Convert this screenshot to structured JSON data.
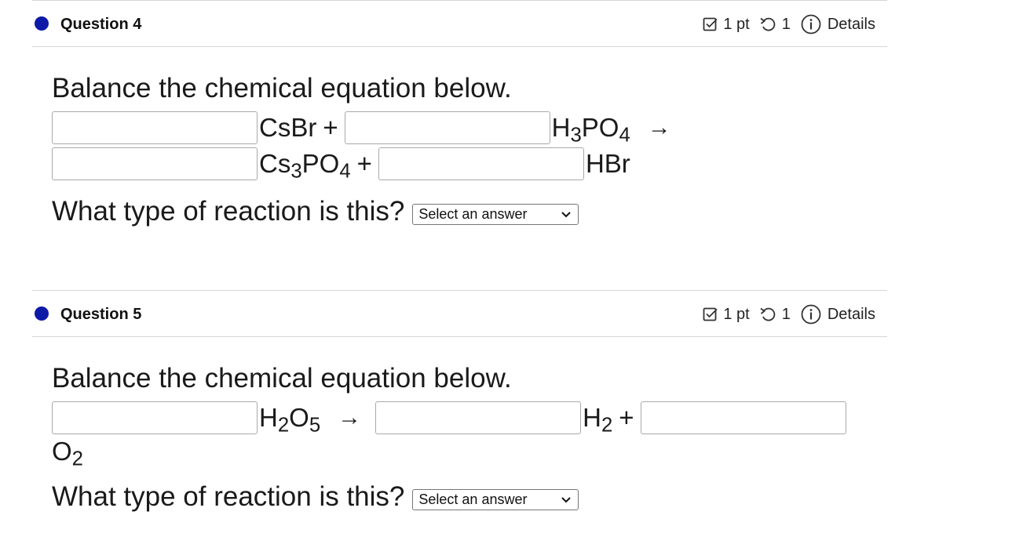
{
  "questions": [
    {
      "title": "Question 4",
      "points": "1 pt",
      "tries": "1",
      "details_label": "Details",
      "prompt": "Balance the chemical equation below.",
      "equation": {
        "r1": {
          "base": "CsBr",
          "parts": []
        },
        "plus1": "+",
        "r2": {
          "parts": [
            [
              "H",
              ""
            ],
            [
              "3",
              "sub"
            ],
            [
              "PO",
              ""
            ],
            [
              "4",
              "sub"
            ]
          ]
        },
        "arrow": "→",
        "p1": {
          "parts": [
            [
              "Cs",
              ""
            ],
            [
              "3",
              "sub"
            ],
            [
              "PO",
              ""
            ],
            [
              "4",
              "sub"
            ]
          ]
        },
        "plus2": "+",
        "p2": {
          "base": "HBr",
          "parts": []
        }
      },
      "coef_values": [
        "",
        "",
        "",
        ""
      ],
      "type_question": "What type of reaction is this?",
      "type_select_value": "Select an answer"
    },
    {
      "title": "Question 5",
      "points": "1 pt",
      "tries": "1",
      "details_label": "Details",
      "prompt": "Balance the chemical equation below.",
      "equation": {
        "r1": {
          "parts": [
            [
              "H",
              ""
            ],
            [
              "2",
              "sub"
            ],
            [
              "O",
              ""
            ],
            [
              "5",
              "sub"
            ]
          ]
        },
        "arrow": "→",
        "p1": {
          "parts": [
            [
              "H",
              ""
            ],
            [
              "2",
              "sub"
            ]
          ]
        },
        "plus1": "+",
        "p2": {
          "parts": [
            [
              "O",
              ""
            ],
            [
              "2",
              "sub"
            ]
          ]
        }
      },
      "coef_values": [
        "",
        "",
        ""
      ],
      "type_question": "What type of reaction is this?",
      "type_select_value": "Select an answer"
    }
  ],
  "colors": {
    "question_dot": "#0d1aa8",
    "divider": "#d6d6d6",
    "input_border": "#a9a9a9"
  },
  "icons": {
    "points": "checkbox-check-icon",
    "tries": "retry-icon",
    "details": "info-icon",
    "select": "chevron-down-icon"
  }
}
